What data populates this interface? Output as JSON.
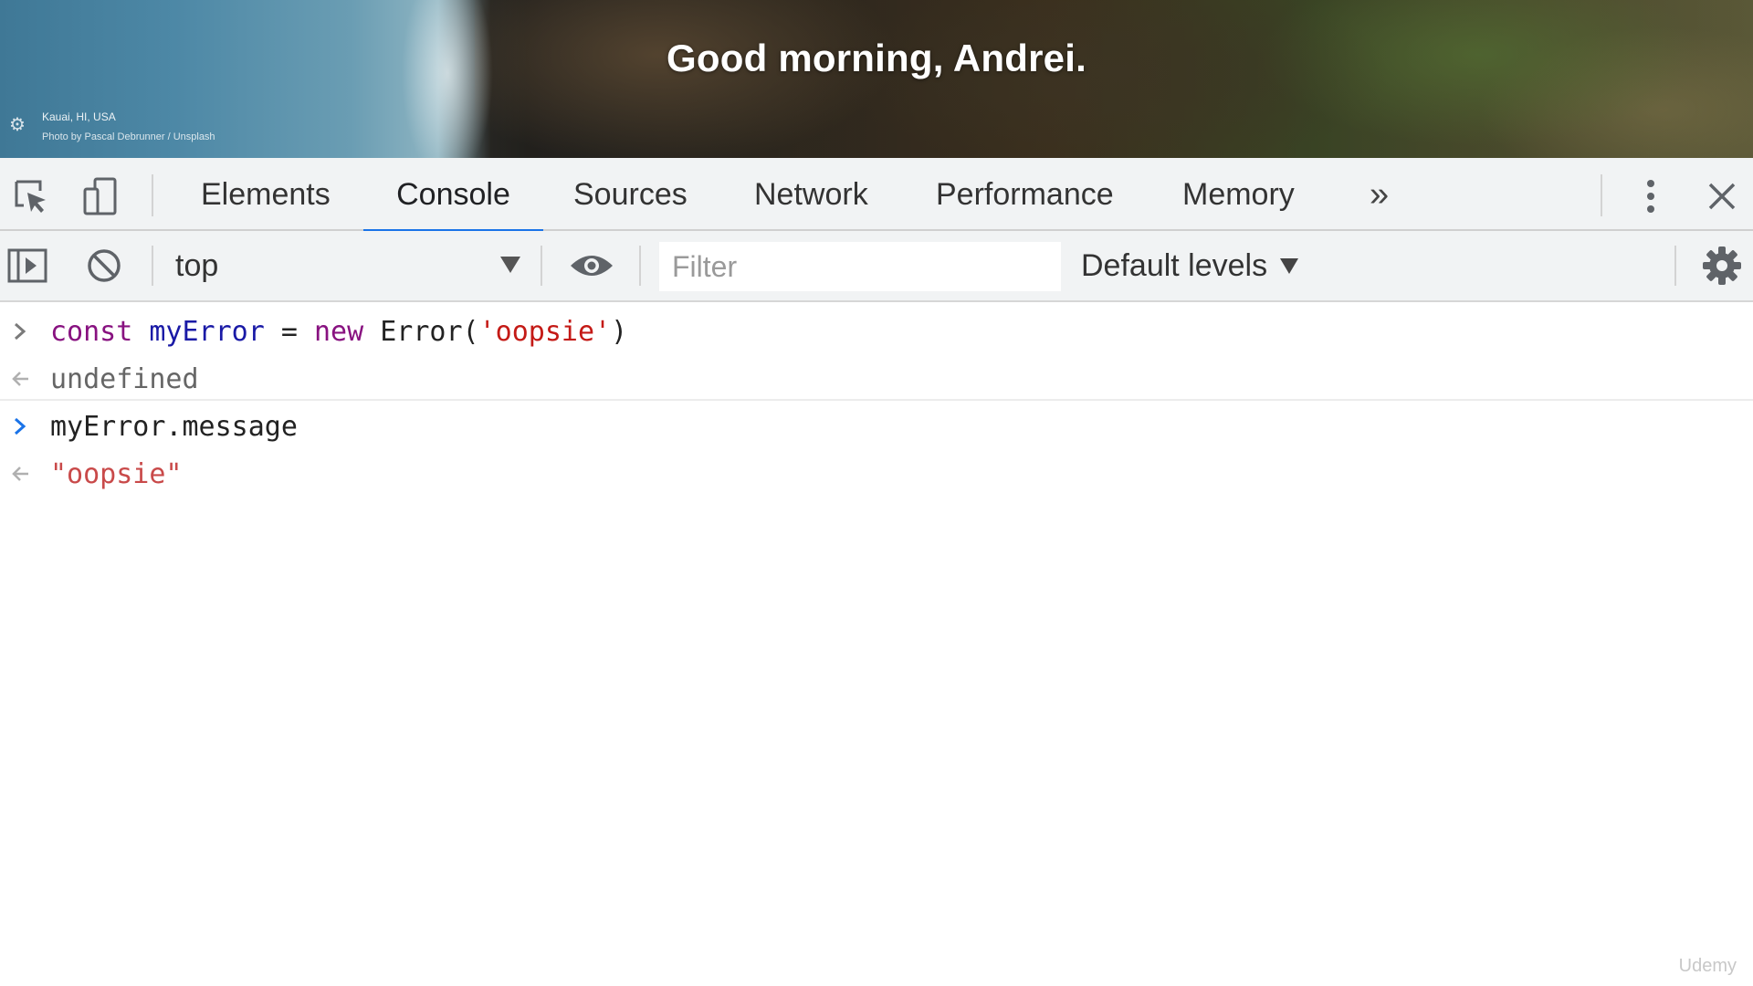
{
  "background_page": {
    "greeting": "Good morning, Andrei.",
    "photo_location": "Kauai, HI, USA",
    "photo_credit": "Photo by Pascal Debrunner / Unsplash"
  },
  "devtools": {
    "tabs": [
      {
        "label": "Elements",
        "active": false
      },
      {
        "label": "Console",
        "active": true
      },
      {
        "label": "Sources",
        "active": false
      },
      {
        "label": "Network",
        "active": false
      },
      {
        "label": "Performance",
        "active": false
      },
      {
        "label": "Memory",
        "active": false
      }
    ],
    "more_tabs_glyph": "»",
    "toolbar": {
      "context": "top",
      "filter_placeholder": "Filter",
      "levels": "Default levels"
    },
    "console": {
      "entries": [
        {
          "type": "input",
          "tokens": [
            {
              "text": "const",
              "style": "kw"
            },
            {
              "text": " ",
              "style": "plain"
            },
            {
              "text": "myError",
              "style": "var"
            },
            {
              "text": " = ",
              "style": "plain"
            },
            {
              "text": "new",
              "style": "kw"
            },
            {
              "text": " Error(",
              "style": "plain"
            },
            {
              "text": "'oopsie'",
              "style": "str"
            },
            {
              "text": ")",
              "style": "plain"
            }
          ]
        },
        {
          "type": "result",
          "text": "undefined"
        },
        {
          "type": "input",
          "text": "myError.message"
        },
        {
          "type": "result",
          "text": "\"oopsie\""
        }
      ]
    }
  },
  "colors": {
    "active_tab_underline": "#1a73e8",
    "keyword": "#881280",
    "variable": "#1a1aa6",
    "string": "#c41a16"
  },
  "watermark": "Udemy"
}
